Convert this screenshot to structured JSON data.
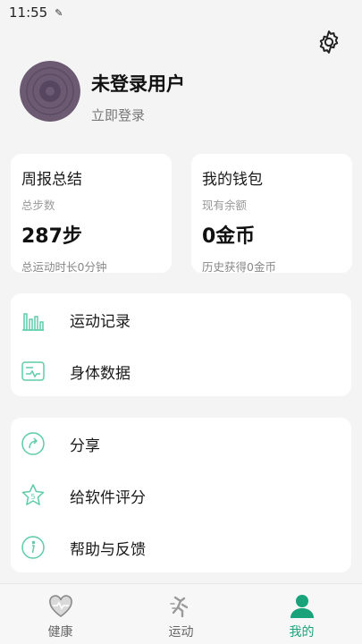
{
  "status_bar": {
    "time": "11:55",
    "edit_glyph": "✎"
  },
  "profile": {
    "name": "未登录用户",
    "login_label": "立即登录"
  },
  "weekly_summary": {
    "title": "周报总结",
    "steps_label": "总步数",
    "steps_value": "287步",
    "duration_text": "总运动时长0分钟"
  },
  "wallet": {
    "title": "我的钱包",
    "balance_label": "现有余额",
    "balance_value": "0金币",
    "history_text": "历史获得0金币"
  },
  "menu_primary": [
    {
      "label": "运动记录",
      "icon": "bar-chart-icon"
    },
    {
      "label": "身体数据",
      "icon": "body-data-icon"
    }
  ],
  "menu_secondary": [
    {
      "label": "分享",
      "icon": "share-icon"
    },
    {
      "label": "给软件评分",
      "icon": "star-rate-icon"
    },
    {
      "label": "帮助与反馈",
      "icon": "help-icon"
    }
  ],
  "tabs": [
    {
      "label": "健康",
      "icon": "heart-pulse-icon",
      "active": false
    },
    {
      "label": "运动",
      "icon": "running-icon",
      "active": false
    },
    {
      "label": "我的",
      "icon": "person-icon",
      "active": true
    }
  ],
  "colors": {
    "accent": "#1aa37a",
    "icon_line": "#5fcbaa",
    "avatar": "#6b5a72"
  }
}
